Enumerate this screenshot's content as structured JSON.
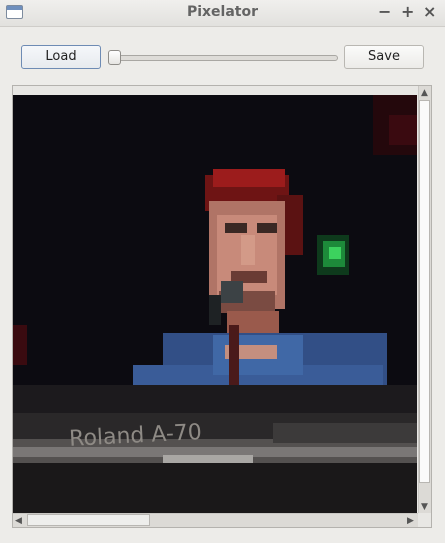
{
  "window": {
    "title": "Pixelator",
    "minimize_glyph": "−",
    "maximize_glyph": "+",
    "close_glyph": "×"
  },
  "toolbar": {
    "load_label": "Load",
    "save_label": "Save",
    "pixel_size": 0
  },
  "viewer": {
    "description_icon": "pixelated-photo",
    "image_text": "Roland A-70"
  }
}
